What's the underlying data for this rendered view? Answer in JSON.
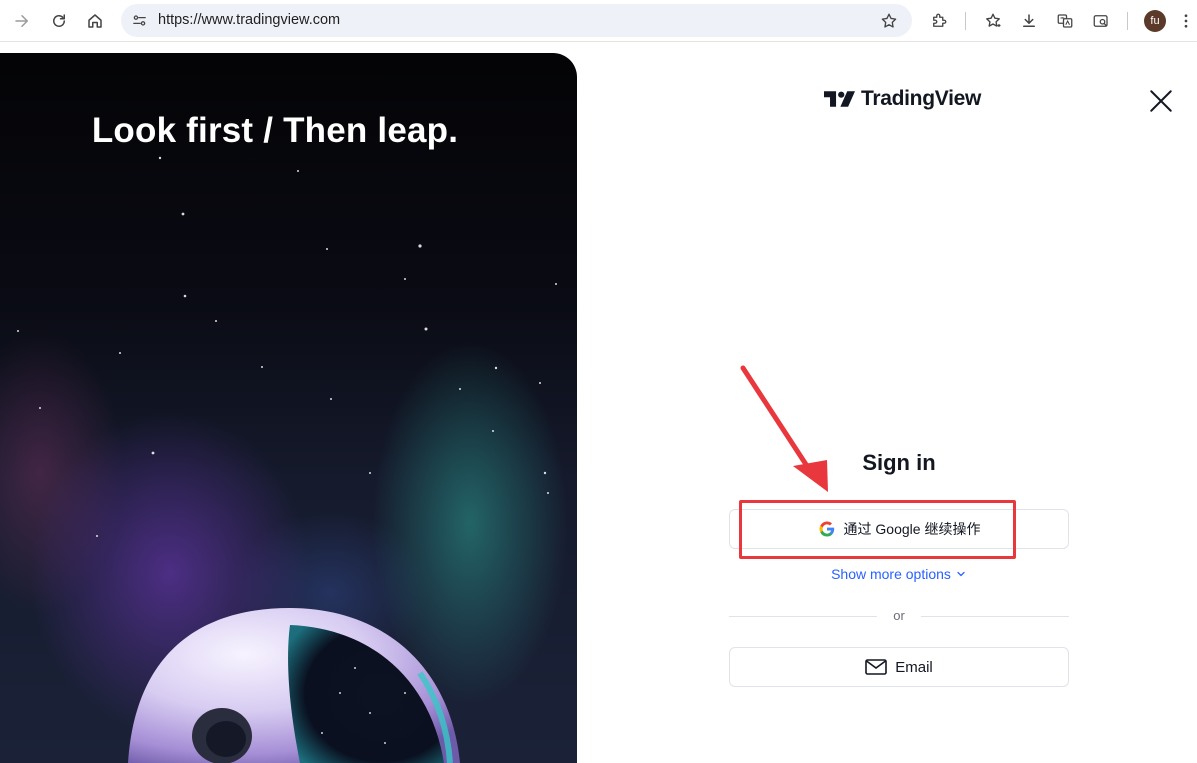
{
  "browser": {
    "url": "https://www.tradingview.com",
    "avatar_initials": "fu",
    "icons": [
      "forward-icon",
      "reload-icon",
      "home-icon",
      "site-info-icon",
      "bookmark-star-icon",
      "extensions-icon",
      "bookmarks-icon",
      "download-icon",
      "translate-icon",
      "search-tab-icon",
      "menu-dots-icon"
    ]
  },
  "hero": {
    "headline": "Look first / Then leap."
  },
  "brand": {
    "name": "TradingView"
  },
  "signin": {
    "title": "Sign in",
    "google_label": "通过 Google 继续操作",
    "more_options_label": "Show more options",
    "divider_label": "or",
    "email_label": "Email"
  },
  "annotation": {
    "highlight_color": "#e8383d"
  },
  "colors": {
    "link": "#2962ff",
    "text": "#131722"
  }
}
